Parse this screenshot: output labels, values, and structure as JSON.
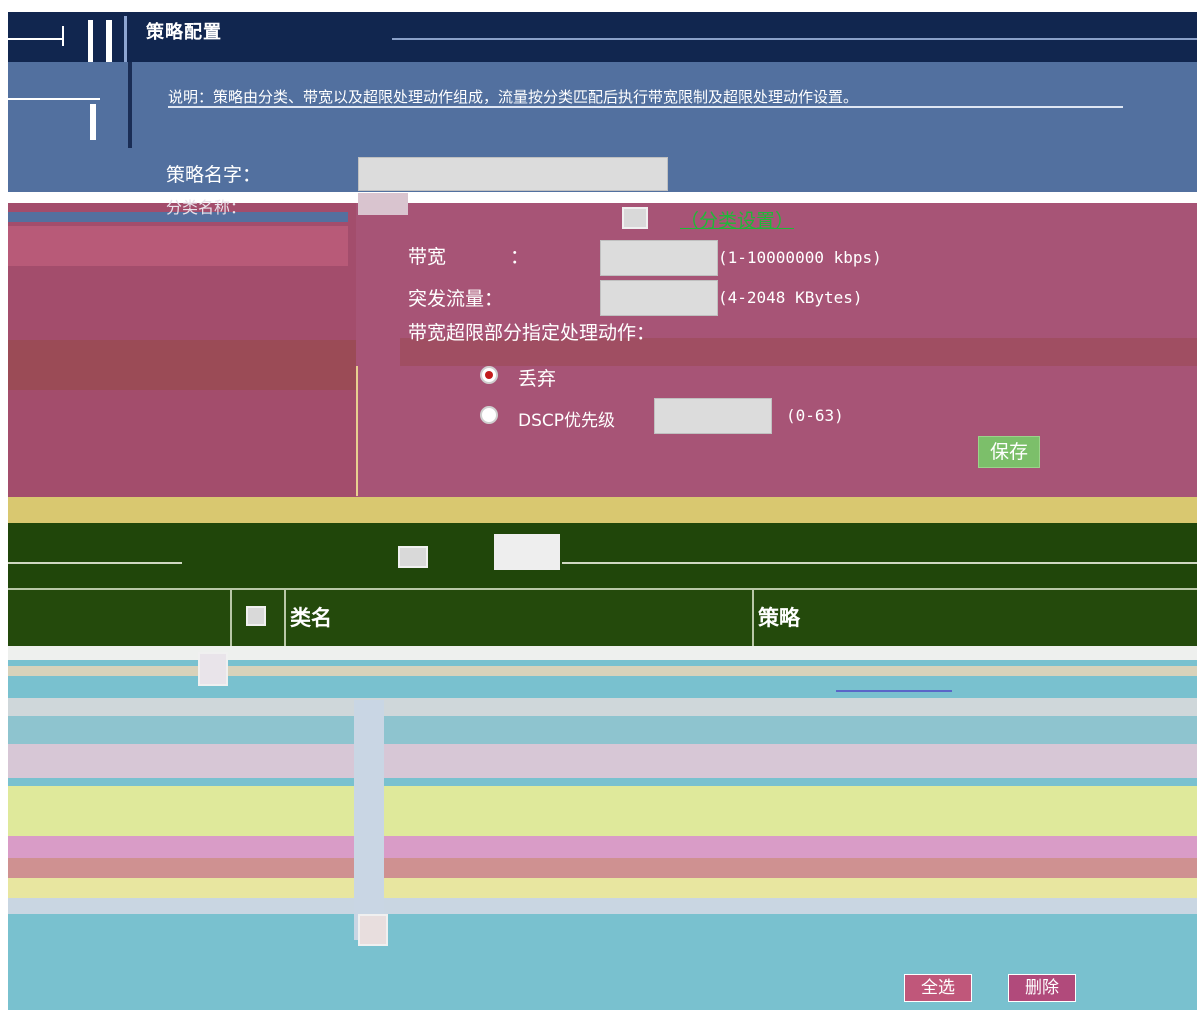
{
  "header": {
    "app_title": "策略配置",
    "info_text": "说明：策略由分类、带宽以及超限处理动作组成，流量按分类匹配后执行带宽限制及超限处理动作设置。"
  },
  "form": {
    "policy_name_label": "策略名字：",
    "policy_name_value": "",
    "class_label": "分类名称：",
    "class_settings_link": "（分类设置）",
    "bandwidth_label": "带宽",
    "bandwidth_colon": "：",
    "bandwidth_value": "",
    "bandwidth_hint": "(1-10000000 kbps)",
    "burst_label": "突发流量：",
    "burst_value": "",
    "burst_hint": "(4-2048 KBytes)",
    "exceed_label": "带宽超限部分指定处理动作：",
    "action_drop_label": "丢弃",
    "action_dscp_label": "DSCP优先级",
    "dscp_value": "",
    "dscp_hint": "(0-63)",
    "save_label": "保存"
  },
  "table": {
    "columns": [
      "类名",
      "策略"
    ]
  },
  "footer": {
    "select_all_label": "全选",
    "delete_label": "删除"
  },
  "colors": {
    "title_bar": "#11264f",
    "info_bar": "#52709f",
    "panel": "#a34d6c",
    "table_header": "#244a0c",
    "link": "#1fb838",
    "save_button": "#7cbf6a"
  }
}
